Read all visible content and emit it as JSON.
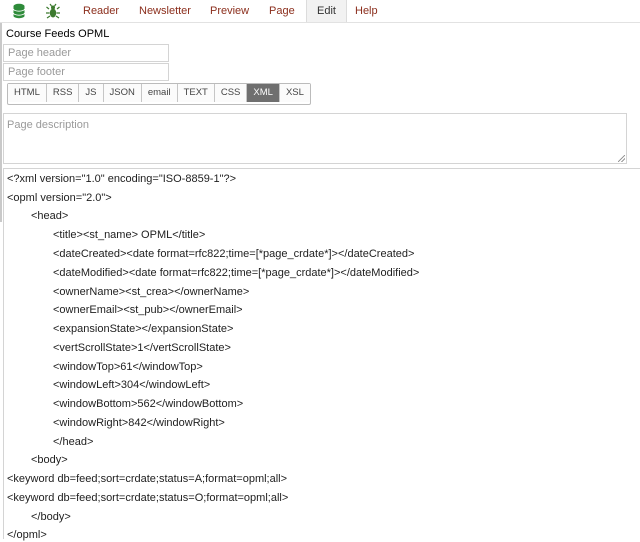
{
  "nav": {
    "items": [
      {
        "label": "Reader",
        "active": false
      },
      {
        "label": "Newsletter",
        "active": false
      },
      {
        "label": "Preview",
        "active": false
      },
      {
        "label": "Page",
        "active": false
      },
      {
        "label": "Edit",
        "active": true
      },
      {
        "label": "Help",
        "active": false
      }
    ],
    "icons": [
      "database-icon",
      "bug-icon"
    ]
  },
  "page": {
    "title": "Course Feeds OPML",
    "header_placeholder": "Page header",
    "footer_placeholder": "Page footer",
    "description_placeholder": "Page description"
  },
  "format_tabs": {
    "items": [
      "HTML",
      "RSS",
      "JS",
      "JSON",
      "email",
      "TEXT",
      "CSS",
      "XML",
      "XSL"
    ],
    "selected": "XML"
  },
  "code": {
    "lines": [
      "<?xml version=\"1.0\" encoding=\"ISO-8859-1\"?>",
      "<opml version=\"2.0\">",
      "<head>",
      "<title><st_name> OPML</title>",
      "<dateCreated><date format=rfc822;time=[*page_crdate*]></dateCreated>",
      "<dateModified><date format=rfc822;time=[*page_crdate*]></dateModified>",
      "<ownerName><st_crea></ownerName>",
      "<ownerEmail><st_pub></ownerEmail>",
      "<expansionState></expansionState>",
      "<vertScrollState>1</vertScrollState>",
      "<windowTop>61</windowTop>",
      "<windowLeft>304</windowLeft>",
      "<windowBottom>562</windowBottom>",
      "<windowRight>842</windowRight>",
      "</head>",
      "<body>",
      "<keyword db=feed;sort=crdate;status=A;format=opml;all>",
      "<keyword db=feed;sort=crdate;status=O;format=opml;all>",
      "</body>",
      "</opml>"
    ]
  },
  "colors": {
    "nav_link": "#8b2e1c",
    "tab_active_bg": "#6f6f6f",
    "database_icon": "#2e8b3a",
    "bug_icon": "#3c7a2e"
  }
}
